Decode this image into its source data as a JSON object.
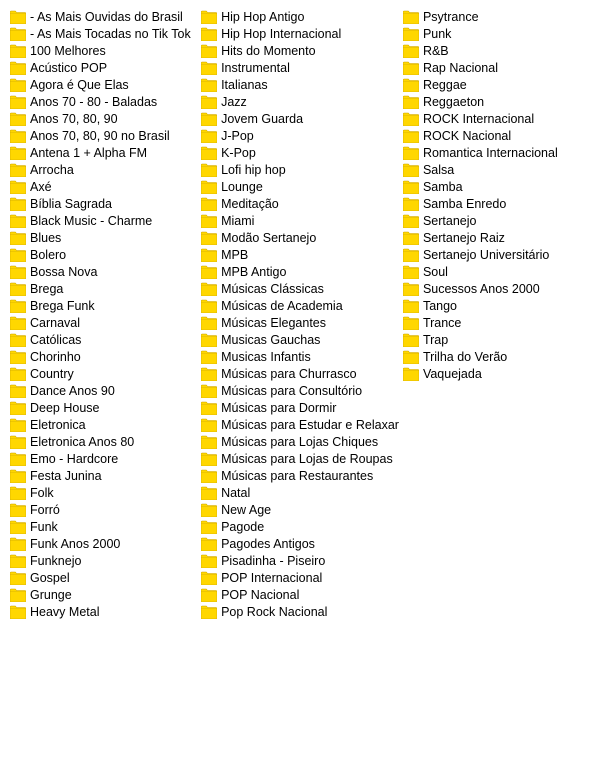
{
  "columns": [
    {
      "id": "col1",
      "items": [
        "- As Mais Ouvidas do Brasil",
        "- As Mais Tocadas no Tik Tok",
        "100 Melhores",
        "Acústico POP",
        "Agora é Que Elas",
        "Anos 70 - 80 - Baladas",
        "Anos 70, 80, 90",
        "Anos 70, 80, 90 no Brasil",
        "Antena 1 + Alpha FM",
        "Arrocha",
        "Axé",
        "Bíblia Sagrada",
        "Black Music - Charme",
        "Blues",
        "Bolero",
        "Bossa Nova",
        "Brega",
        "Brega Funk",
        "Carnaval",
        "Católicas",
        "Chorinho",
        "Country",
        "Dance Anos 90",
        "Deep House",
        "Eletronica",
        "Eletronica Anos 80",
        "Emo - Hardcore",
        "Festa Junina",
        "Folk",
        "Forró",
        "Funk",
        "Funk Anos 2000",
        "Funknejo",
        "Gospel",
        "Grunge",
        "Heavy Metal"
      ]
    },
    {
      "id": "col2",
      "items": [
        "Hip Hop Antigo",
        "Hip Hop Internacional",
        "Hits do Momento",
        "Instrumental",
        "Italianas",
        "Jazz",
        "Jovem Guarda",
        "J-Pop",
        "K-Pop",
        "Lofi hip hop",
        "Lounge",
        "Meditação",
        "Miami",
        "Modão Sertanejo",
        "MPB",
        "MPB Antigo",
        "Músicas Clássicas",
        "Músicas de Academia",
        "Músicas Elegantes",
        "Musicas Gauchas",
        "Musicas Infantis",
        "Músicas para Churrasco",
        "Músicas para Consultório",
        "Músicas para Dormir",
        "Músicas para Estudar e Relaxar",
        "Músicas para Lojas Chiques",
        "Músicas para Lojas de Roupas",
        "Músicas para Restaurantes",
        "Natal",
        "New Age",
        "Pagode",
        "Pagodes Antigos",
        "Pisadinha - Piseiro",
        "POP Internacional",
        "POP Nacional",
        "Pop Rock Nacional"
      ]
    },
    {
      "id": "col3",
      "items": [
        "Psytrance",
        "Punk",
        "R&B",
        "Rap Nacional",
        "Reggae",
        "Reggaeton",
        "ROCK Internacional",
        "ROCK Nacional",
        "Romantica Internacional",
        "Salsa",
        "Samba",
        "Samba Enredo",
        "Sertanejo",
        "Sertanejo Raiz",
        "Sertanejo Universitário",
        "Soul",
        "Sucessos Anos 2000",
        "Tango",
        "Trance",
        "Trap",
        "Trilha do Verão",
        "Vaquejada"
      ]
    }
  ],
  "folder_icon_color": "#FFD700"
}
